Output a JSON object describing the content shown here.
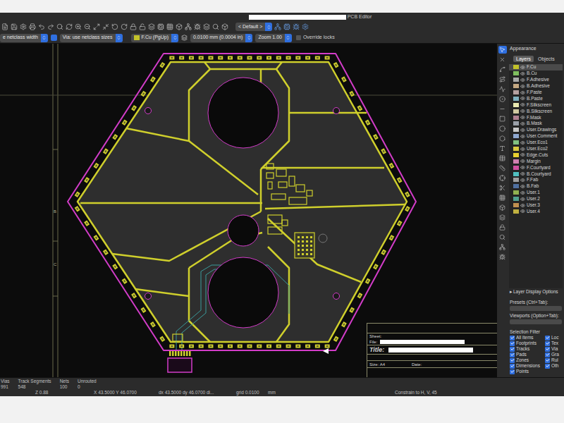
{
  "window": {
    "title": "PCB Editor"
  },
  "toolbar": {
    "preset": "< Default >"
  },
  "options_bar": {
    "track_width": "e netclass width",
    "via_size": "Via: use netclass sizes",
    "layer": "F.Cu (PgUp)",
    "layer_color": "#c2c22a",
    "grid": "0.0100 mm (0.0004 in)",
    "zoom": "Zoom 1.00",
    "override_locks": {
      "label": "Override locks",
      "checked": false
    }
  },
  "canvas": {
    "border_labels": [
      {
        "text": "B"
      },
      {
        "text": "C"
      }
    ],
    "title_block": {
      "sheet": "Sheet:",
      "file": "File:",
      "title": "Title:",
      "size": "Size: A4",
      "date": "Date:"
    }
  },
  "appearance": {
    "title": "Appearance",
    "tabs": [
      {
        "label": "Layers",
        "selected": true
      },
      {
        "label": "Objects",
        "selected": false
      }
    ],
    "layers": [
      {
        "name": "F.Cu",
        "visible": true,
        "selected": true,
        "color": "#c2c22a"
      },
      {
        "name": "B.Cu",
        "visible": true,
        "selected": false,
        "color": "#7fbf5f"
      },
      {
        "name": "F.Adhesive",
        "visible": true,
        "selected": false,
        "color": "#a9a9a9"
      },
      {
        "name": "B.Adhesive",
        "visible": true,
        "selected": false,
        "color": "#c4a882"
      },
      {
        "name": "F.Paste",
        "visible": true,
        "selected": false,
        "color": "#b4a0a0"
      },
      {
        "name": "B.Paste",
        "visible": true,
        "selected": false,
        "color": "#7fb0c0"
      },
      {
        "name": "F.Silkscreen",
        "visible": true,
        "selected": false,
        "color": "#e8e8b0"
      },
      {
        "name": "B.Silkscreen",
        "visible": true,
        "selected": false,
        "color": "#d0c8a0"
      },
      {
        "name": "F.Mask",
        "visible": true,
        "selected": false,
        "color": "#b08090"
      },
      {
        "name": "B.Mask",
        "visible": true,
        "selected": false,
        "color": "#9aa0a8"
      },
      {
        "name": "User.Drawings",
        "visible": true,
        "selected": false,
        "color": "#c8c8c8"
      },
      {
        "name": "User.Comment",
        "visible": true,
        "selected": false,
        "color": "#8fa8d0"
      },
      {
        "name": "User.Eco1",
        "visible": true,
        "selected": false,
        "color": "#80c080"
      },
      {
        "name": "User.Eco2",
        "visible": true,
        "selected": false,
        "color": "#d8c840"
      },
      {
        "name": "Edge.Cuts",
        "visible": true,
        "selected": false,
        "color": "#e8d030"
      },
      {
        "name": "Margin",
        "visible": true,
        "selected": false,
        "color": "#d080b0"
      },
      {
        "name": "F.Courtyard",
        "visible": true,
        "selected": false,
        "color": "#d050a0"
      },
      {
        "name": "B.Courtyard",
        "visible": true,
        "selected": false,
        "color": "#50c0c0"
      },
      {
        "name": "F.Fab",
        "visible": true,
        "selected": false,
        "color": "#a0a0a0"
      },
      {
        "name": "B.Fab",
        "visible": true,
        "selected": false,
        "color": "#5070a0"
      },
      {
        "name": "User.1",
        "visible": true,
        "selected": false,
        "color": "#90b050"
      },
      {
        "name": "User.2",
        "visible": true,
        "selected": false,
        "color": "#50a090"
      },
      {
        "name": "User.3",
        "visible": true,
        "selected": false,
        "color": "#c09050"
      },
      {
        "name": "User.4",
        "visible": true,
        "selected": false,
        "color": "#c0b040"
      }
    ],
    "layer_display_options": {
      "arrow": "▸",
      "label": "Layer Display Options"
    },
    "presets_label": "Presets (Ctrl+Tab):",
    "viewports_label": "Viewports (Option+Tab):"
  },
  "selection_filter": {
    "title": "Selection Filter",
    "items": [
      {
        "label": "All items",
        "checked": true
      },
      {
        "label": "Loc",
        "checked": true
      },
      {
        "label": "Footprints",
        "checked": true
      },
      {
        "label": "Tex",
        "checked": true
      },
      {
        "label": "Tracks",
        "checked": true
      },
      {
        "label": "Via",
        "checked": true
      },
      {
        "label": "Pads",
        "checked": true
      },
      {
        "label": "Gra",
        "checked": true
      },
      {
        "label": "Zones",
        "checked": true
      },
      {
        "label": "Rul",
        "checked": true
      },
      {
        "label": "Dimensions",
        "checked": true
      },
      {
        "label": "Oth",
        "checked": true
      },
      {
        "label": "Points",
        "checked": true
      }
    ]
  },
  "status_bar": {
    "stats": [
      {
        "label": "Vias",
        "value": "991"
      },
      {
        "label": "Track Segments",
        "value": "548"
      },
      {
        "label": "Nets",
        "value": "100"
      },
      {
        "label": "Unrouted",
        "value": "0"
      }
    ],
    "zoom": "Z 0.88",
    "cursor": "X 43.5000 Y 46.0700",
    "delta": "dx 43.5000 dy 46.0700 di...",
    "grid": "grid 0.0100",
    "units": "mm",
    "constraint": "Constrain to H, V, 45"
  }
}
